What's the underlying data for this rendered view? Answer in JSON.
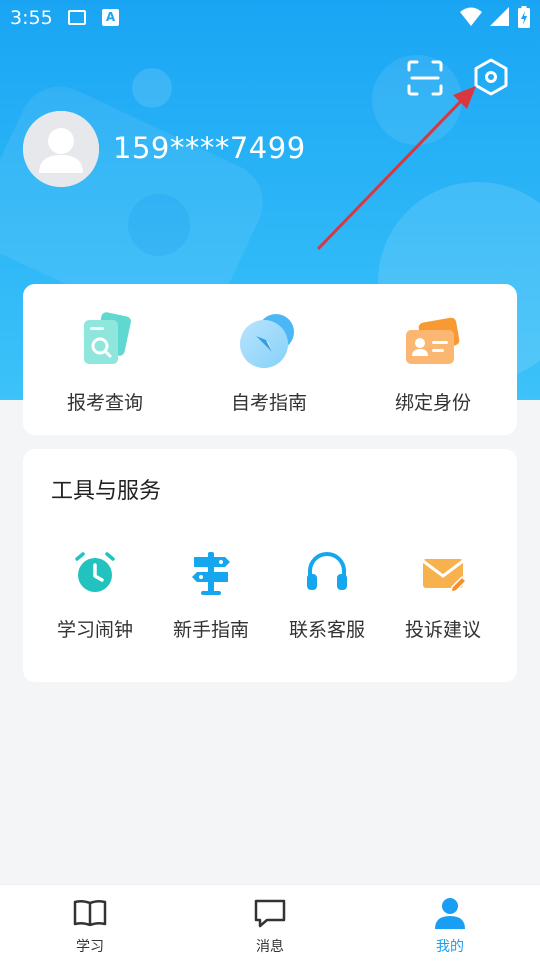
{
  "status_bar": {
    "time": "3:55",
    "icons": [
      "image-icon",
      "a-icon",
      "wifi-icon",
      "signal-icon",
      "battery-charging-icon"
    ]
  },
  "header": {
    "phone": "159****7499",
    "scan_icon": "scan-icon",
    "settings_icon": "settings-hexagon-icon"
  },
  "quick_actions": [
    {
      "label": "报考查询",
      "icon": "document-search-icon"
    },
    {
      "label": "自考指南",
      "icon": "compass-icon"
    },
    {
      "label": "绑定身份",
      "icon": "id-card-icon"
    }
  ],
  "tools": {
    "title": "工具与服务",
    "items": [
      {
        "label": "学习闹钟",
        "icon": "alarm-clock-icon"
      },
      {
        "label": "新手指南",
        "icon": "signpost-icon"
      },
      {
        "label": "联系客服",
        "icon": "headset-icon"
      },
      {
        "label": "投诉建议",
        "icon": "mail-edit-icon"
      }
    ]
  },
  "bottom_nav": [
    {
      "label": "学习",
      "icon": "book-icon",
      "active": false
    },
    {
      "label": "消息",
      "icon": "message-icon",
      "active": false
    },
    {
      "label": "我的",
      "icon": "user-icon",
      "active": true
    }
  ],
  "colors": {
    "header_blue": "#1aa5f4",
    "accent_blue": "#1a9ef4",
    "annotation_arrow": "#d9363e",
    "teal": "#20c4c0",
    "orange": "#f7a23b"
  }
}
